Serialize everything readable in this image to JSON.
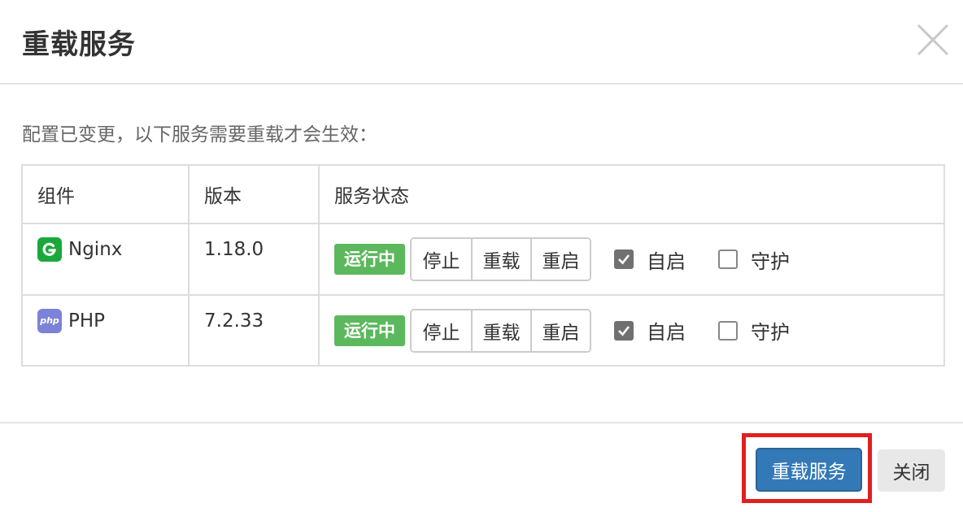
{
  "dialog": {
    "title": "重载服务",
    "notice": "配置已变更，以下服务需要重载才会生效："
  },
  "table": {
    "headers": [
      "组件",
      "版本",
      "服务状态"
    ],
    "rows": [
      {
        "component": "Nginx",
        "icon": "nginx-icon",
        "version": "1.18.0",
        "status": "运行中",
        "actions": [
          "停止",
          "重载",
          "重启"
        ],
        "autostart_label": "自启",
        "autostart_checked": true,
        "guard_label": "守护",
        "guard_checked": false
      },
      {
        "component": "PHP",
        "icon": "php-icon",
        "icon_text": "php",
        "version": "7.2.33",
        "status": "运行中",
        "actions": [
          "停止",
          "重载",
          "重启"
        ],
        "autostart_label": "自启",
        "autostart_checked": true,
        "guard_label": "守护",
        "guard_checked": false
      }
    ]
  },
  "footer": {
    "primary_label": "重载服务",
    "close_label": "关闭"
  },
  "colors": {
    "status_green": "#5cb85c",
    "primary_blue": "#3379b7",
    "highlight_red": "#e02020",
    "nginx_green": "#1aa83a",
    "php_purple": "#7b82d8"
  }
}
